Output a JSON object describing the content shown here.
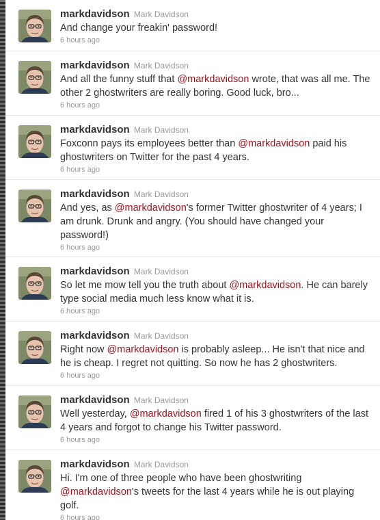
{
  "tweets": [
    {
      "screen_name": "markdavidson",
      "full_name": "Mark Davidson",
      "segments": [
        {
          "t": "text",
          "v": "And change your freakin' password!"
        }
      ],
      "time": "6 hours ago"
    },
    {
      "screen_name": "markdavidson",
      "full_name": "Mark Davidson",
      "segments": [
        {
          "t": "text",
          "v": "And all the funny stuff that "
        },
        {
          "t": "mention",
          "v": "@markdavidson"
        },
        {
          "t": "text",
          "v": " wrote, that was all me. The other 2 ghostwriters are really boring. Good luck, bro..."
        }
      ],
      "time": "6 hours ago"
    },
    {
      "screen_name": "markdavidson",
      "full_name": "Mark Davidson",
      "segments": [
        {
          "t": "text",
          "v": "Foxconn pays its employees better than "
        },
        {
          "t": "mention",
          "v": "@markdavidson"
        },
        {
          "t": "text",
          "v": " paid his ghostwriters on Twitter for the past 4 years."
        }
      ],
      "time": "6 hours ago"
    },
    {
      "screen_name": "markdavidson",
      "full_name": "Mark Davidson",
      "segments": [
        {
          "t": "text",
          "v": "And yes, as "
        },
        {
          "t": "mention",
          "v": "@markdavidson"
        },
        {
          "t": "text",
          "v": "'s former Twitter ghostwriter of 4 years; I am drunk. Drunk and angry. (You should have changed your password!)"
        }
      ],
      "time": "6 hours ago"
    },
    {
      "screen_name": "markdavidson",
      "full_name": "Mark Davidson",
      "segments": [
        {
          "t": "text",
          "v": "So let me mow tell you the truth about "
        },
        {
          "t": "mention",
          "v": "@markdavidson"
        },
        {
          "t": "text",
          "v": ". He can barely type social media much less know what it is."
        }
      ],
      "time": "6 hours ago"
    },
    {
      "screen_name": "markdavidson",
      "full_name": "Mark Davidson",
      "segments": [
        {
          "t": "text",
          "v": "Right now "
        },
        {
          "t": "mention",
          "v": "@markdavidson"
        },
        {
          "t": "text",
          "v": " is probably asleep... He isn't that nice and he is cheap. I regret not quitting. So now he has 2 ghostwriters."
        }
      ],
      "time": "6 hours ago"
    },
    {
      "screen_name": "markdavidson",
      "full_name": "Mark Davidson",
      "segments": [
        {
          "t": "text",
          "v": "Well yesterday, "
        },
        {
          "t": "mention",
          "v": "@markdavidson"
        },
        {
          "t": "text",
          "v": " fired 1 of his 3 ghostwriters of the last 4 years and forgot to change his Twitter password."
        }
      ],
      "time": "6 hours ago"
    },
    {
      "screen_name": "markdavidson",
      "full_name": "Mark Davidson",
      "segments": [
        {
          "t": "text",
          "v": "Hi. I'm one of three people who have been ghostwriting "
        },
        {
          "t": "mention",
          "v": "@markdavidson"
        },
        {
          "t": "text",
          "v": "'s tweets for the last 4 years while he is out playing golf."
        }
      ],
      "time": "6 hours ago"
    }
  ],
  "colors": {
    "mention": "#a0131b",
    "screen_name": "#333333",
    "meta": "#999999",
    "background": "#ffffff",
    "divider": "#e8e8e8"
  },
  "icons": {
    "avatar": "profile-photo-avatar"
  }
}
